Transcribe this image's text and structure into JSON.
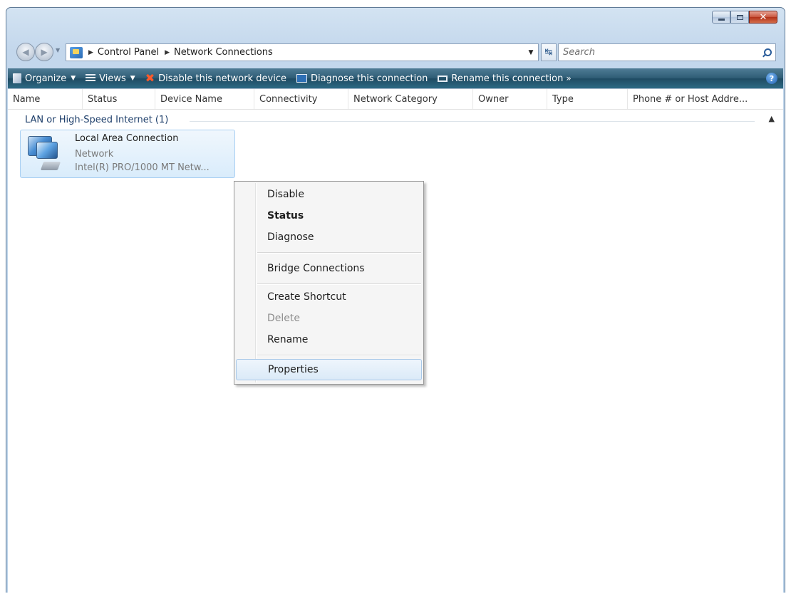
{
  "window": {
    "caption_buttons": [
      "minimize",
      "maximize",
      "close"
    ]
  },
  "address_bar": {
    "breadcrumbs": [
      "Control Panel",
      "Network Connections"
    ]
  },
  "search": {
    "placeholder": "Search"
  },
  "command_bar": {
    "items": [
      {
        "label": "Organize",
        "icon": "organize-icon",
        "dropdown": true
      },
      {
        "label": "Views",
        "icon": "views-icon",
        "dropdown": true
      },
      {
        "label": "Disable this network device",
        "icon": "disable-x-icon"
      },
      {
        "label": "Diagnose this connection",
        "icon": "diagnose-icon"
      },
      {
        "label": "Rename this connection",
        "icon": "rename-icon"
      }
    ],
    "overflow": "»",
    "help": "?"
  },
  "columns": [
    "Name",
    "Status",
    "Device Name",
    "Connectivity",
    "Network Category",
    "Owner",
    "Type",
    "Phone # or Host Addre..."
  ],
  "group": {
    "header": "LAN or High-Speed Internet (1)"
  },
  "connection": {
    "name": "Local Area Connection",
    "status": "Network",
    "device": "Intel(R) PRO/1000 MT Netw..."
  },
  "context_menu": {
    "items": [
      {
        "label": "Disable",
        "style": "normal"
      },
      {
        "label": "Status",
        "style": "bold"
      },
      {
        "label": "Diagnose",
        "style": "normal"
      },
      {
        "label": "Bridge Connections",
        "style": "normal"
      },
      {
        "label": "Create Shortcut",
        "style": "normal"
      },
      {
        "label": "Delete",
        "style": "disabled"
      },
      {
        "label": "Rename",
        "style": "normal"
      },
      {
        "label": "Properties",
        "style": "highlighted"
      }
    ]
  },
  "colors": {
    "command_bar": "#2f5d76",
    "selection": "#d9ecfb",
    "close_button": "#c9553c"
  }
}
